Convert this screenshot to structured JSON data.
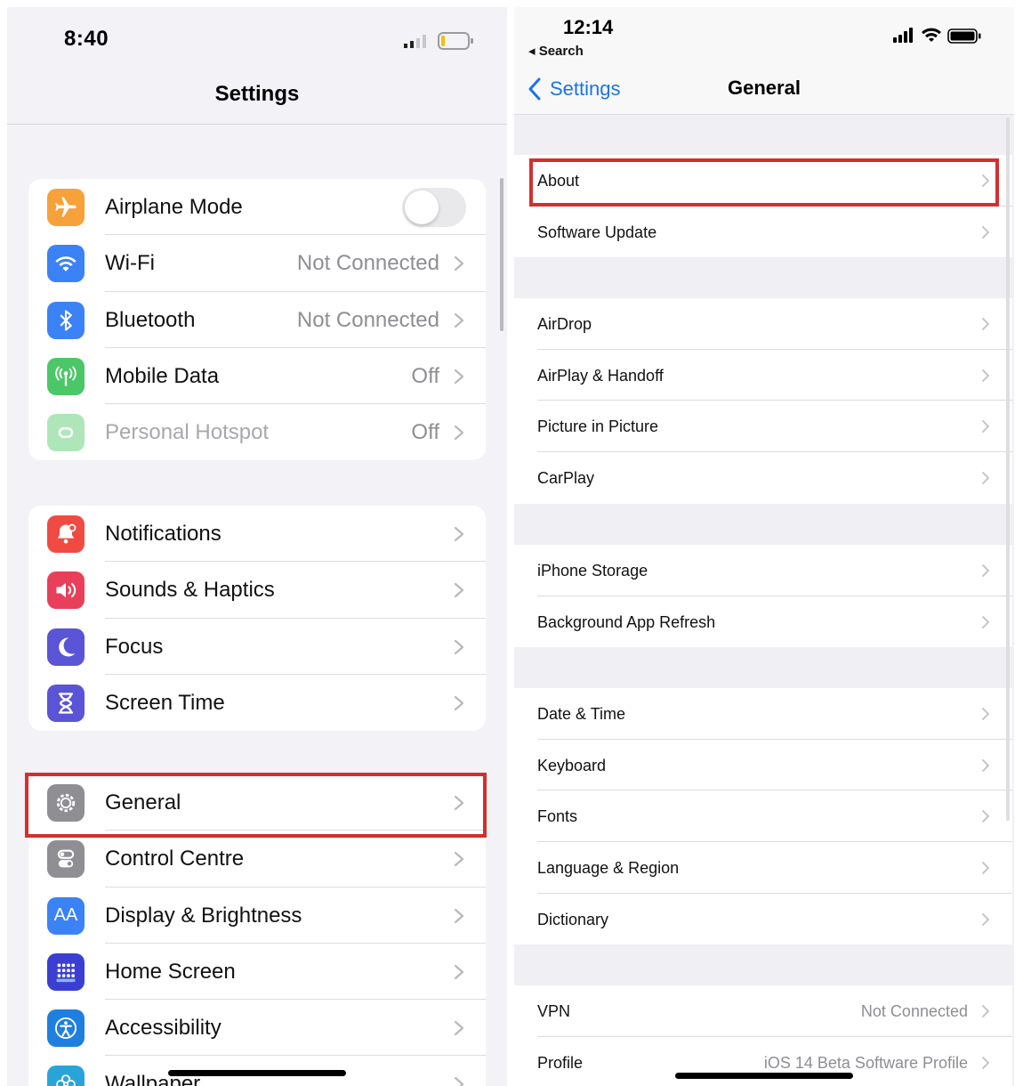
{
  "left": {
    "status_time": "8:40",
    "title": "Settings",
    "groups": [
      [
        {
          "label": "Airplane Mode",
          "icon": "airplane-icon",
          "color": "#f7a13a",
          "toggle": "off"
        },
        {
          "label": "Wi-Fi",
          "value": "Not Connected",
          "icon": "wifi-icon",
          "color": "#3b82f6"
        },
        {
          "label": "Bluetooth",
          "value": "Not Connected",
          "icon": "bluetooth-icon",
          "color": "#3b82f6"
        },
        {
          "label": "Mobile Data",
          "value": "Off",
          "icon": "antenna-icon",
          "color": "#4cc767"
        },
        {
          "label": "Personal Hotspot",
          "value": "Off",
          "icon": "hotspot-icon",
          "color": "#4cc767",
          "disabled": true
        }
      ],
      [
        {
          "label": "Notifications",
          "icon": "notifications-icon",
          "color": "#ef4b43"
        },
        {
          "label": "Sounds & Haptics",
          "icon": "speaker-icon",
          "color": "#e8405a"
        },
        {
          "label": "Focus",
          "icon": "moon-icon",
          "color": "#5a54d6"
        },
        {
          "label": "Screen Time",
          "icon": "hourglass-icon",
          "color": "#5a54d6"
        }
      ],
      [
        {
          "label": "General",
          "icon": "gear-icon",
          "color": "#8e8e93"
        },
        {
          "label": "Control Centre",
          "icon": "switches-icon",
          "color": "#8e8e93"
        },
        {
          "label": "Display & Brightness",
          "icon": "text-size-icon",
          "color": "#3b82f6",
          "glyph": "AA"
        },
        {
          "label": "Home Screen",
          "icon": "grid-icon",
          "color": "#3b3fd1"
        },
        {
          "label": "Accessibility",
          "icon": "accessibility-icon",
          "color": "#1e7fe0"
        },
        {
          "label": "Wallpaper",
          "icon": "flower-icon",
          "color": "#2aa4d8"
        }
      ]
    ]
  },
  "right": {
    "status_time": "12:14",
    "back_app": "◂ Search",
    "back_label": "Settings",
    "title": "General",
    "groups": [
      [
        {
          "label": "About"
        },
        {
          "label": "Software Update"
        }
      ],
      [
        {
          "label": "AirDrop"
        },
        {
          "label": "AirPlay & Handoff"
        },
        {
          "label": "Picture in Picture"
        },
        {
          "label": "CarPlay"
        }
      ],
      [
        {
          "label": "iPhone Storage"
        },
        {
          "label": "Background App Refresh"
        }
      ],
      [
        {
          "label": "Date & Time"
        },
        {
          "label": "Keyboard"
        },
        {
          "label": "Fonts"
        },
        {
          "label": "Language & Region"
        },
        {
          "label": "Dictionary"
        }
      ],
      [
        {
          "label": "VPN",
          "value": "Not Connected"
        },
        {
          "label": "Profile",
          "value": "iOS 14 Beta Software Profile"
        }
      ]
    ]
  },
  "colors": {
    "highlight": "#d32f2f",
    "link_blue": "#1a73e8"
  }
}
